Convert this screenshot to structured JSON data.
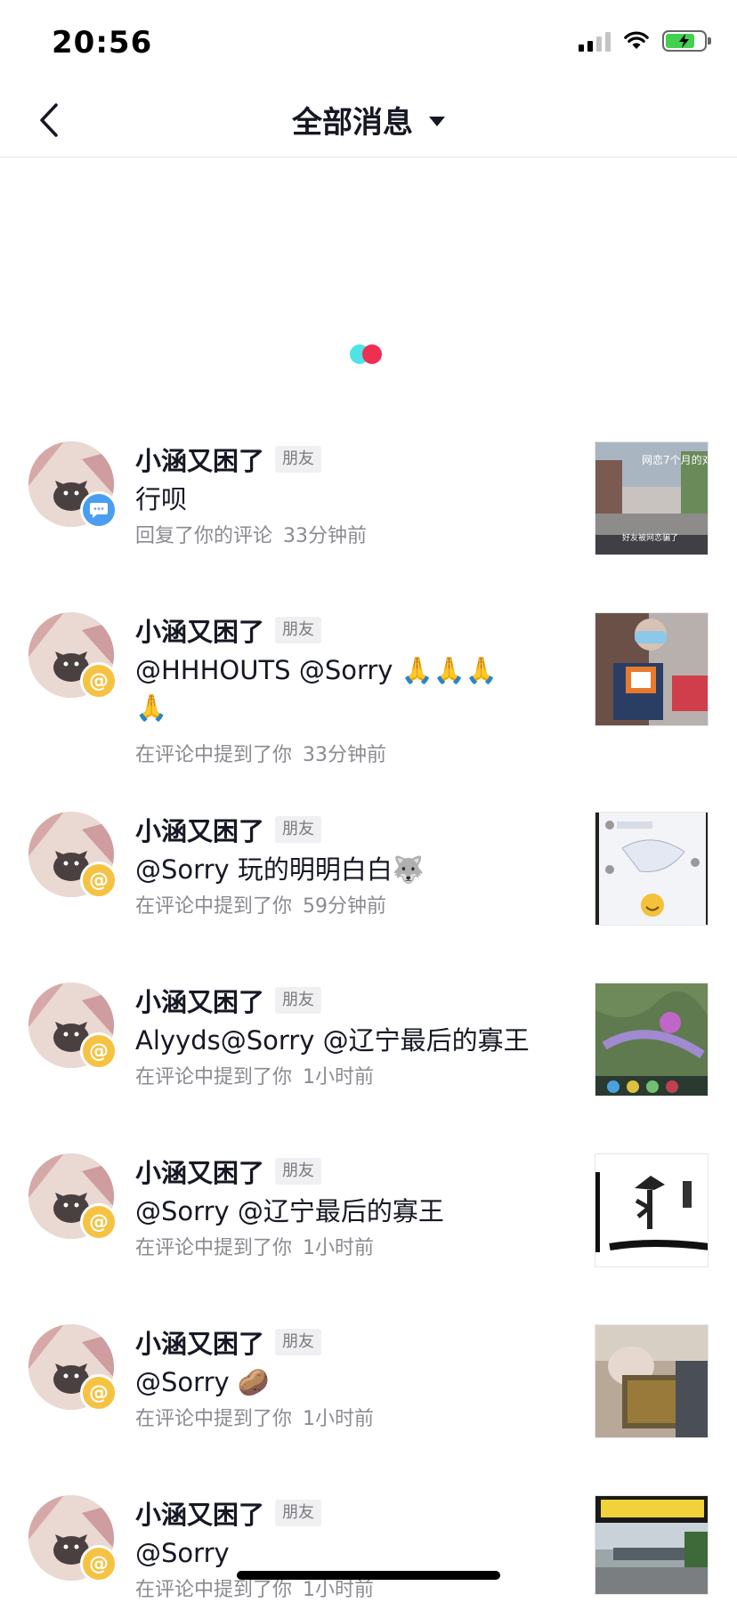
{
  "status_bar": {
    "time": "20:56"
  },
  "nav": {
    "title": "全部消息"
  },
  "messages": [
    {
      "name": "小涵又困了",
      "tag": "朋友",
      "content": "行呗",
      "action": "回复了你的评论",
      "time": "33分钟前",
      "badge": "comment-icon"
    },
    {
      "name": "小涵又困了",
      "tag": "朋友",
      "content": "@HHHOUTS @Sorry 🙏🙏🙏🙏",
      "action": "在评论中提到了你",
      "time": "33分钟前",
      "badge": "at-icon"
    },
    {
      "name": "小涵又困了",
      "tag": "朋友",
      "content": "@Sorry 玩的明明白白🐺",
      "action": "在评论中提到了你",
      "time": "59分钟前",
      "badge": "at-icon"
    },
    {
      "name": "小涵又困了",
      "tag": "朋友",
      "content": "Alyyds@Sorry @辽宁最后的寡王",
      "action": "在评论中提到了你",
      "time": "1小时前",
      "badge": "at-icon"
    },
    {
      "name": "小涵又困了",
      "tag": "朋友",
      "content": "@Sorry @辽宁最后的寡王",
      "action": "在评论中提到了你",
      "time": "1小时前",
      "badge": "at-icon"
    },
    {
      "name": "小涵又困了",
      "tag": "朋友",
      "content": "@Sorry 🥔",
      "action": "在评论中提到了你",
      "time": "1小时前",
      "badge": "at-icon"
    },
    {
      "name": "小涵又困了",
      "tag": "朋友",
      "content": "@Sorry",
      "action": "在评论中提到了你",
      "time": "1小时前",
      "badge": "at-icon"
    }
  ],
  "thumb_texts": {
    "t1": "网恋7个月的对",
    "t1b": "好友被网恋骗了"
  },
  "colors": {
    "accent_red": "#ee2f52",
    "accent_cyan": "#4fe3e5",
    "badge_at": "#f5c242",
    "badge_comment": "#4a9ef0"
  }
}
